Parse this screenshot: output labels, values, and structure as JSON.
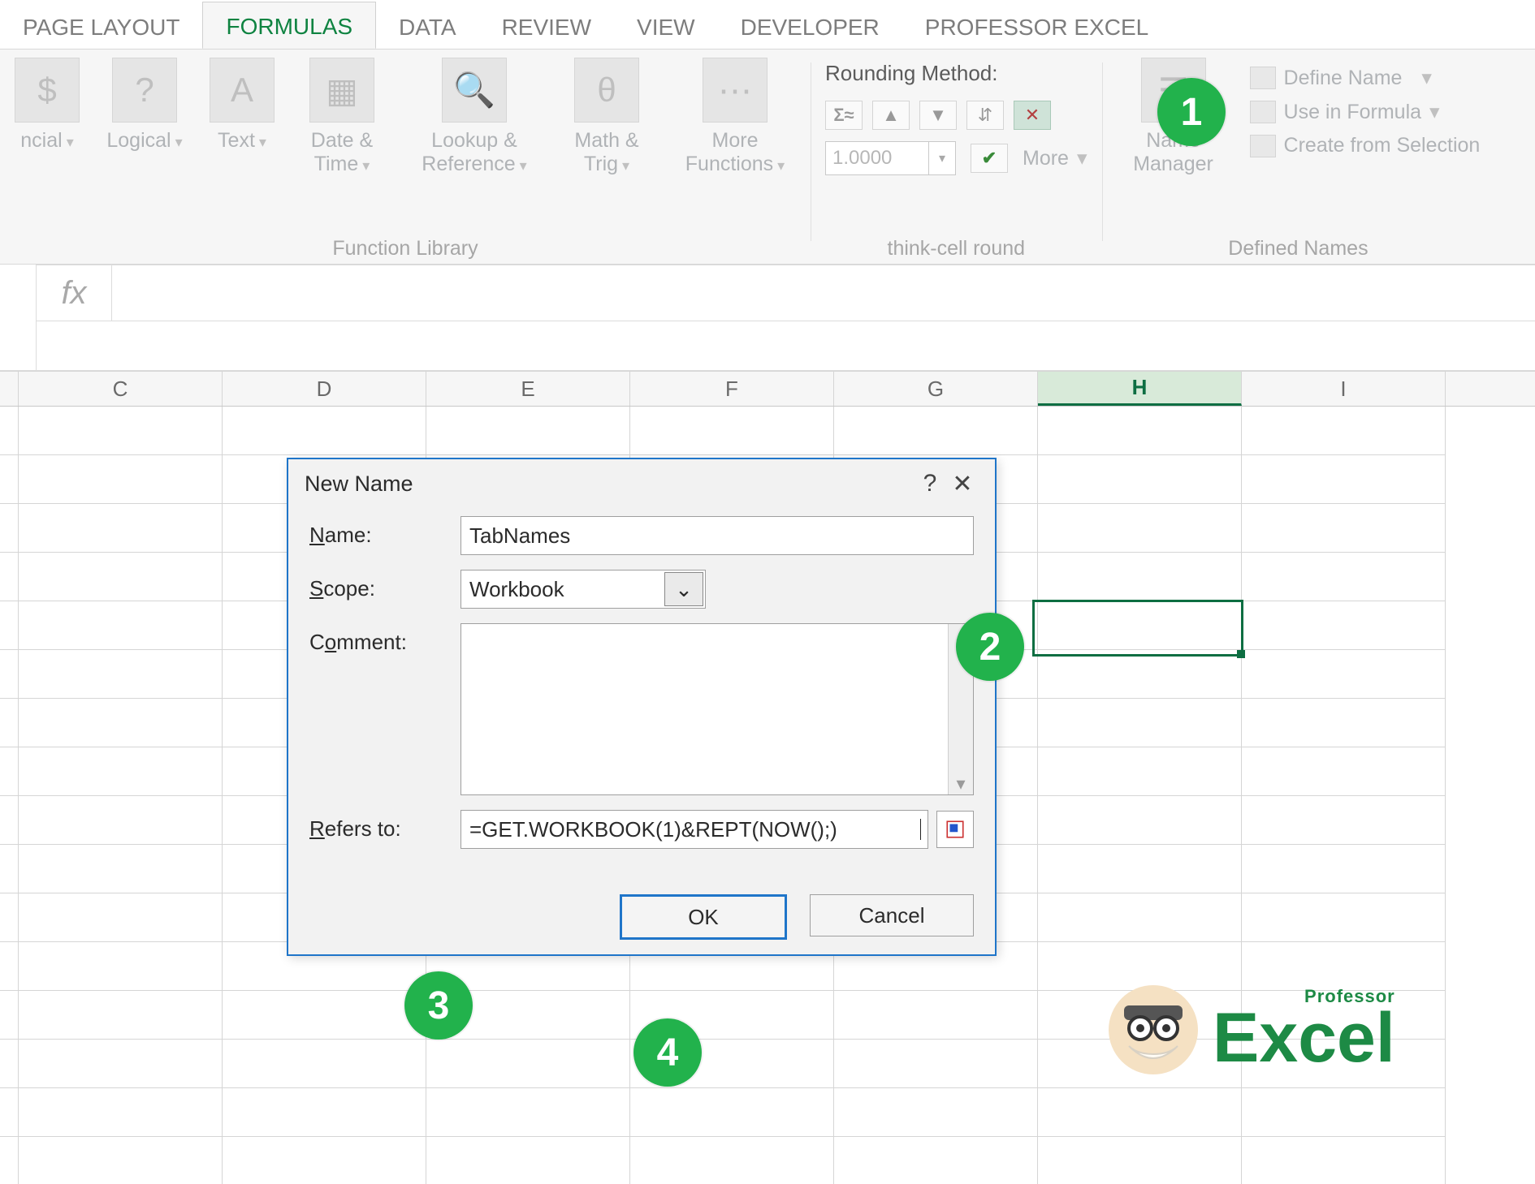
{
  "tabs": {
    "page_layout": "PAGE LAYOUT",
    "formulas": "FORMULAS",
    "data": "DATA",
    "review": "REVIEW",
    "view": "VIEW",
    "developer": "DEVELOPER",
    "professor_excel": "PROFESSOR EXCEL",
    "active": "formulas"
  },
  "ribbon": {
    "function_library": {
      "label": "Function Library",
      "buttons": {
        "financial": "ncial",
        "logical": "Logical",
        "text": "Text",
        "date_time": "Date & Time",
        "lookup": "Lookup & Reference",
        "math_trig": "Math & Trig",
        "more_fn": "More Functions"
      }
    },
    "thinkcell": {
      "label": "think-cell round",
      "heading": "Rounding Method:",
      "value": "1.0000",
      "more": "More"
    },
    "defined_names": {
      "label": "Defined Names",
      "name_manager": "Name Manager",
      "define_name": "Define Name",
      "use_in_formula": "Use in Formula",
      "create_from_selection": "Create from Selection"
    }
  },
  "formula_bar": {
    "fx": "fx",
    "value": ""
  },
  "columns": [
    "C",
    "D",
    "E",
    "F",
    "G",
    "H",
    "I"
  ],
  "selected_column": "H",
  "dialog": {
    "title": "New Name",
    "labels": {
      "name": "Name:",
      "scope": "Scope:",
      "comment": "Comment:",
      "refers_to": "Refers to:"
    },
    "name_value": "TabNames",
    "scope_value": "Workbook",
    "comment_value": "",
    "refers_to_value": "=GET.WORKBOOK(1)&REPT(NOW();)",
    "buttons": {
      "ok": "OK",
      "cancel": "Cancel"
    }
  },
  "badges": {
    "b1": "1",
    "b2": "2",
    "b3": "3",
    "b4": "4"
  },
  "logo": {
    "professor": "Professor",
    "excel": "Excel"
  }
}
